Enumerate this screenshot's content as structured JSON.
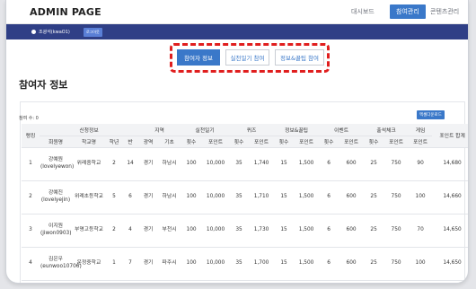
{
  "header": {
    "title": "ADMIN PAGE",
    "nav": [
      "대시보드",
      "참여관리",
      "콘텐츠관리"
    ],
    "active_nav": "참여관리"
  },
  "user": {
    "name": "조광석(kwaO1)",
    "logout_label": "로그아웃"
  },
  "tabs": [
    {
      "label": "참여자 정보",
      "active": true
    },
    {
      "label": "실천일기 참여",
      "active": false
    },
    {
      "label": "정보&꿀팁 참여",
      "active": false
    }
  ],
  "page": {
    "title": "참여자 정보",
    "count_label": "참여 수: 0",
    "excel_button": "엑셀다운로드"
  },
  "table": {
    "group_headers": [
      "신청정보",
      "지역",
      "실천일기",
      "퀴즈",
      "정보&꿀팁",
      "이벤트",
      "출석체크",
      "게임"
    ],
    "rank_header": "랭킹",
    "total_header": "포인트 합계",
    "sub_headers": [
      "회원명",
      "학교명",
      "학년",
      "반",
      "광역",
      "기초",
      "횟수",
      "포인트",
      "횟수",
      "포인트",
      "횟수",
      "포인트",
      "횟수",
      "포인트",
      "횟수",
      "포인트",
      "포인트"
    ],
    "rows": [
      [
        "1",
        "강예원 (lovelyewon)",
        "위례중학교",
        "2",
        "14",
        "경기",
        "하남시",
        "100",
        "10,000",
        "35",
        "1,740",
        "15",
        "1,500",
        "6",
        "600",
        "25",
        "750",
        "90",
        "14,680"
      ],
      [
        "2",
        "강예진 (lovelyejin)",
        "위례초등학교",
        "5",
        "6",
        "경기",
        "하남시",
        "100",
        "10,000",
        "35",
        "1,710",
        "15",
        "1,500",
        "6",
        "600",
        "25",
        "750",
        "100",
        "14,660"
      ],
      [
        "3",
        "이지원 (jiwon0903)",
        "부명고등학교",
        "2",
        "4",
        "경기",
        "부천시",
        "100",
        "10,000",
        "35",
        "1,730",
        "15",
        "1,500",
        "6",
        "600",
        "25",
        "750",
        "70",
        "14,650"
      ],
      [
        "4",
        "김은우 (eunwoo10706)",
        "운정중학교",
        "1",
        "7",
        "경기",
        "파주시",
        "100",
        "10,000",
        "35",
        "1,700",
        "15",
        "1,500",
        "6",
        "600",
        "25",
        "750",
        "100",
        "14,650"
      ]
    ]
  },
  "colors": {
    "accent": "#3a78c9",
    "userbar": "#2f3f86",
    "highlight": "#e01e1e"
  }
}
